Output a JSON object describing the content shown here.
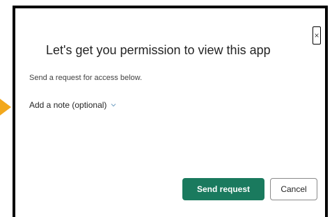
{
  "dialog": {
    "title": "Let's get you permission to view this app",
    "subtitle": "Send a request for access below.",
    "close_glyph": "×",
    "note_toggle_label": "Add a note (optional)",
    "note_toggle_icon": "chevron-down-icon",
    "send_button_label": "Send request",
    "cancel_button_label": "Cancel"
  },
  "colors": {
    "primary": "#1a7a5e",
    "arrow": "#f2a81d",
    "border": "#000000"
  }
}
